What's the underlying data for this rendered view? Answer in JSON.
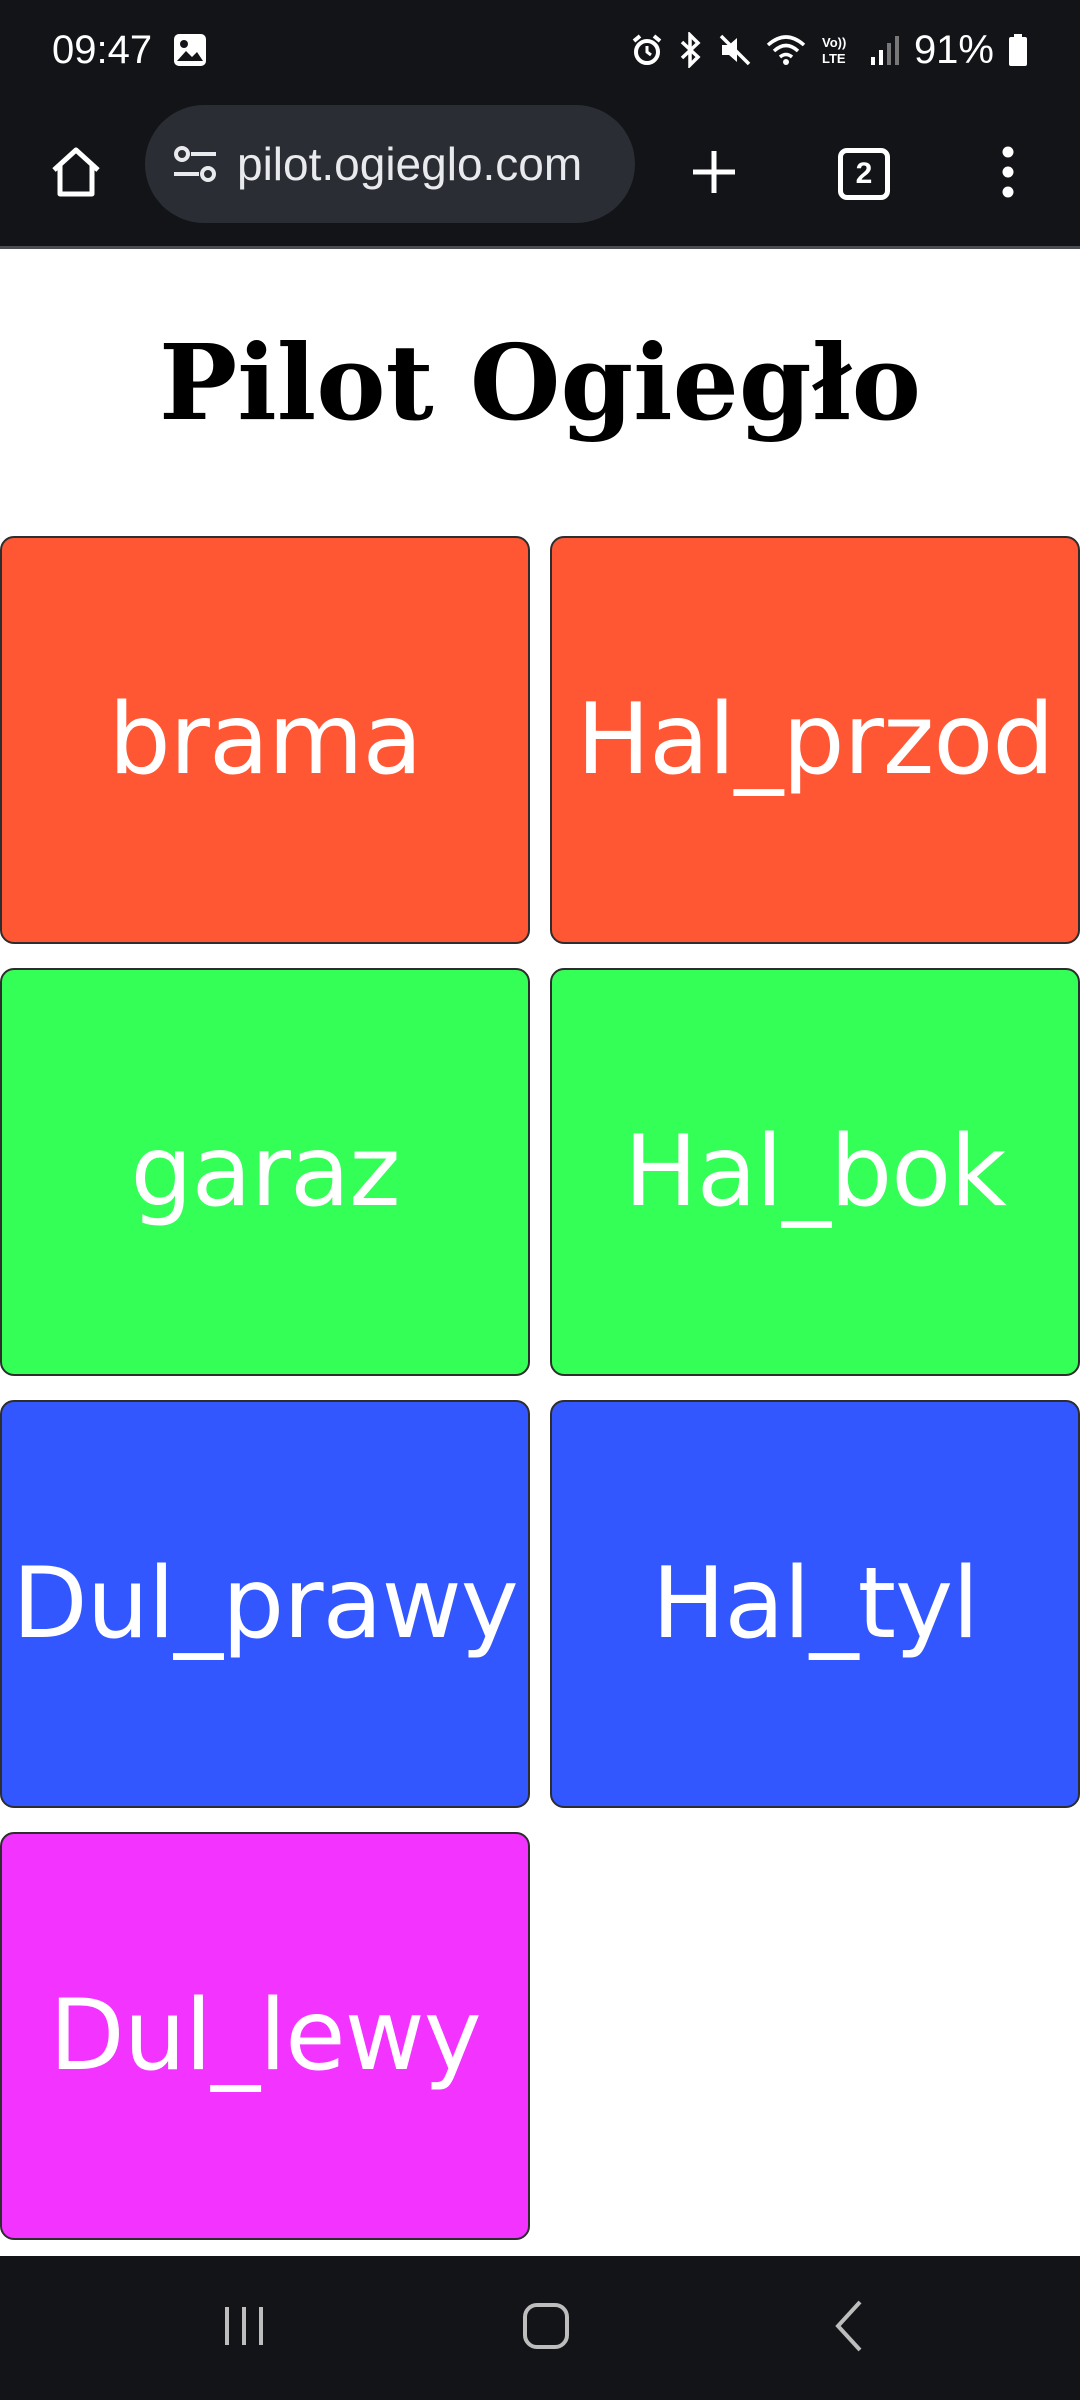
{
  "status_bar": {
    "time": "09:47",
    "battery": "91%",
    "icons": [
      "image-icon",
      "alarm-icon",
      "bluetooth-icon",
      "mute-icon",
      "wifi-icon",
      "volte-icon",
      "signal-icon",
      "battery-icon"
    ]
  },
  "browser": {
    "url": "pilot.ogieglo.com",
    "tab_count": "2",
    "icons": [
      "home-icon",
      "site-settings-icon",
      "new-tab-icon",
      "tab-switcher-icon",
      "more-menu-icon"
    ]
  },
  "page": {
    "title": "Pilot Ogiegło",
    "buttons": [
      {
        "label": "brama",
        "color": "#FF5733"
      },
      {
        "label": "Hal_przod",
        "color": "#FF5733"
      },
      {
        "label": "garaz",
        "color": "#33FF57"
      },
      {
        "label": "Hal_bok",
        "color": "#33FF57"
      },
      {
        "label": "Dul_prawy",
        "color": "#3357FF"
      },
      {
        "label": "Hal_tyl",
        "color": "#3357FF"
      },
      {
        "label": "Dul_lewy",
        "color": "#F333FF"
      }
    ]
  },
  "nav_bar": {
    "icons": [
      "recent-apps-icon",
      "home-nav-icon",
      "back-icon"
    ]
  },
  "colors": {
    "chrome_bg": "#121417",
    "omnibox_bg": "#2A2D33",
    "page_bg": "#FFFFFF"
  }
}
